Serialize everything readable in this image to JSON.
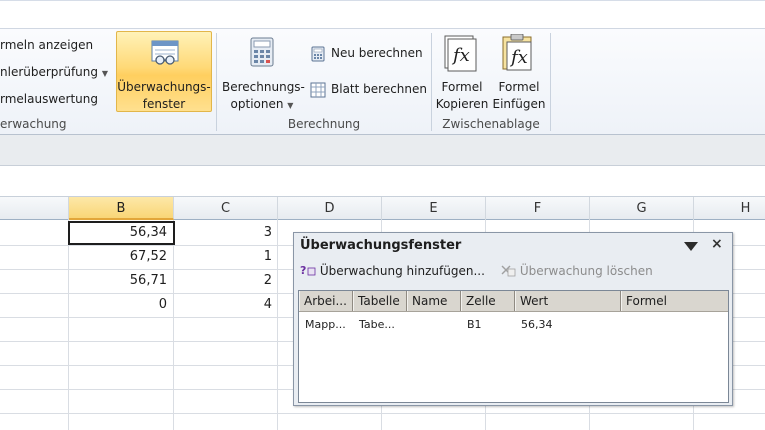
{
  "ribbon": {
    "formula_group_items": [
      "rmeln anzeigen",
      "nlerüberprüfung",
      "rmelauswertung"
    ],
    "formula_group_label": "erwachung",
    "watch_window_label_line1": "Überwachungs-",
    "watch_window_label_line2": "fenster",
    "calc_options_line1": "Berechnungs-",
    "calc_options_line2": "optionen",
    "calc_now": "Neu berechnen",
    "calc_sheet": "Blatt berechnen",
    "calc_group_label": "Berechnung",
    "copy_formula_line1": "Formel",
    "copy_formula_line2": "Kopieren",
    "paste_formula_line1": "Formel",
    "paste_formula_line2": "Einfügen",
    "clipboard_group_label": "Zwischenablage"
  },
  "sheet": {
    "columns": [
      "B",
      "C",
      "D",
      "E",
      "F",
      "G",
      "H"
    ],
    "selected_column": "B",
    "rows": [
      {
        "b": "56,34",
        "c": "3"
      },
      {
        "b": "67,52",
        "c": "1"
      },
      {
        "b": "56,71",
        "c": "2"
      },
      {
        "b": "0",
        "c": "4"
      }
    ]
  },
  "watch_window": {
    "title": "Überwachungsfenster",
    "add_label": "Überwachung hinzufügen...",
    "delete_label": "Überwachung löschen",
    "headers": [
      "Arbei...",
      "Tabelle",
      "Name",
      "Zelle",
      "Wert",
      "Formel"
    ],
    "entries": [
      {
        "book": "Mapp...",
        "sheet": "Tabe...",
        "name": "",
        "cell": "B1",
        "value": "56,34",
        "formula": ""
      }
    ]
  },
  "colors": {
    "selection_accent": "#ffd977",
    "ribbon_bg": "#eef2f8"
  }
}
